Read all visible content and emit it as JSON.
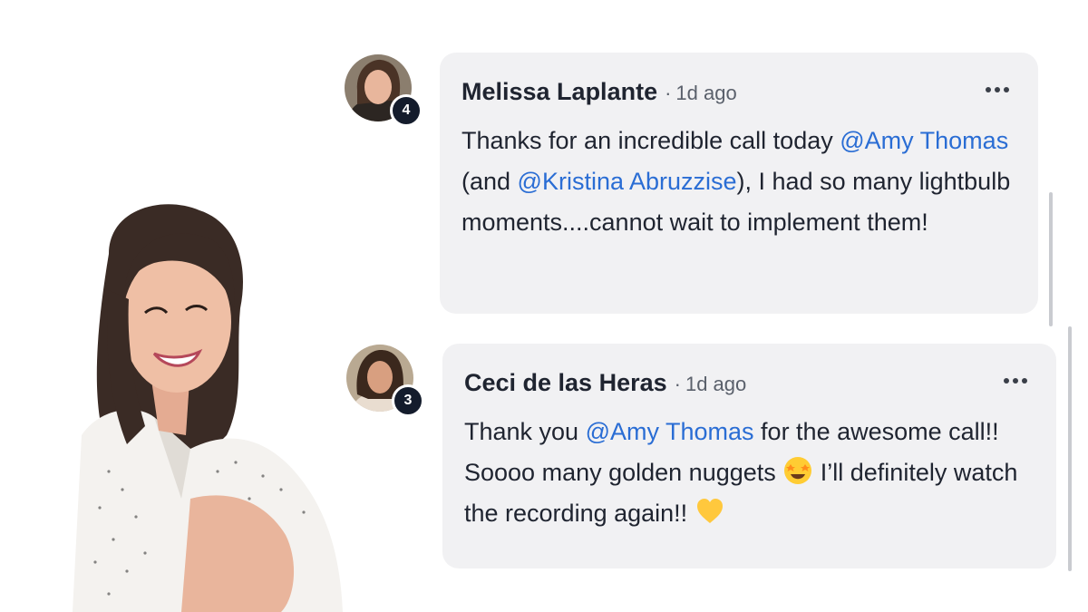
{
  "comments": [
    {
      "author": "Melissa Laplante",
      "separator": "·",
      "time": "1d ago",
      "level": "4",
      "text": {
        "t1": "Thanks for an incredible call today ",
        "m1": "@Amy Thomas",
        "t2": " (and ",
        "m2": "@Kristina Abruzzise",
        "t3": "), I had so many lightbulb moments....cannot wait to implement them!"
      }
    },
    {
      "author": "Ceci de las Heras",
      "separator": "·",
      "time": "1d ago",
      "level": "3",
      "text": {
        "t1": "Thank you ",
        "m1": "@Amy Thomas",
        "t2": " for the awesome call!! Soooo many golden nuggets ",
        "t3": " I’ll definitely watch the recording again!! "
      }
    }
  ],
  "icons": {
    "more": "more-horizontal-icon",
    "emoji1": "star-struck-emoji",
    "emoji2": "yellow-heart-emoji"
  },
  "colors": {
    "mention": "#2a6dd4",
    "bubble": "#f1f1f3",
    "badge": "#141c2c"
  }
}
